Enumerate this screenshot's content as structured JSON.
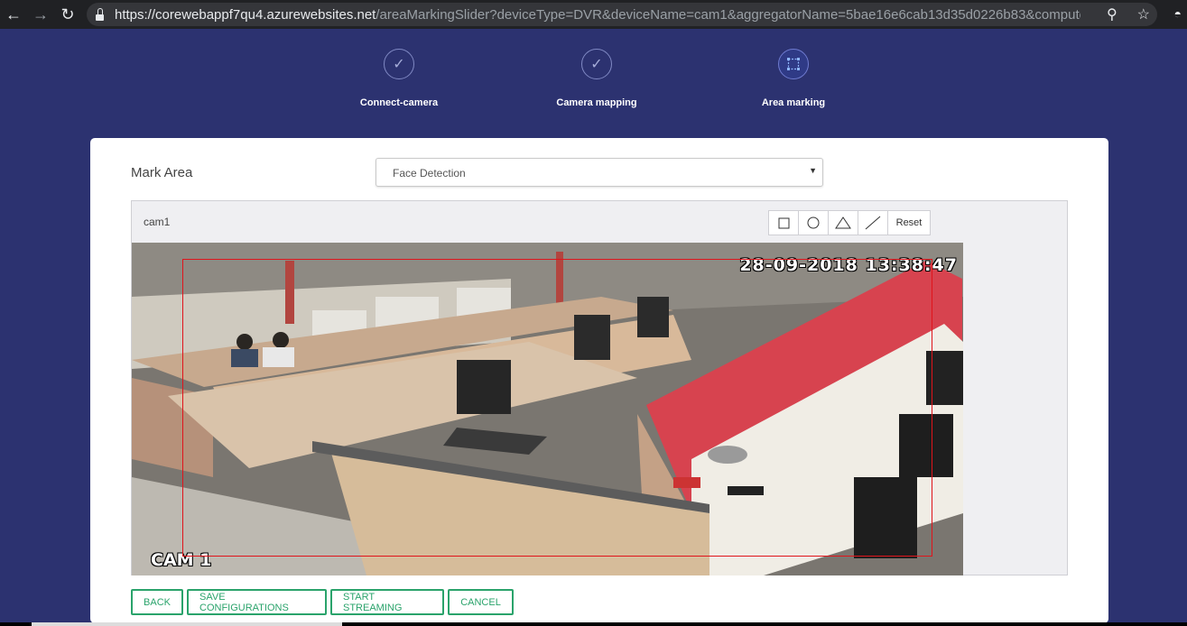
{
  "browser": {
    "url_host": "https://corewebappf7qu4.azurewebsites.net",
    "url_rest": "/areaMarkingSlider?deviceType=DVR&deviceName=cam1&aggregatorName=5bae16e6cab13d35d0226b83&computeEngineNa..."
  },
  "steps": [
    {
      "label": "Connect-camera",
      "icon": "check-icon"
    },
    {
      "label": "Camera mapping",
      "icon": "check-icon"
    },
    {
      "label": "Area marking",
      "icon": "selection-square-icon"
    }
  ],
  "form": {
    "mark_area_label": "Mark Area",
    "selected_option": "Face Detection"
  },
  "camera": {
    "name": "cam1",
    "timestamp": "28-09-2018 13:38:47",
    "overlay_label": "CAM 1"
  },
  "toolbar": {
    "tools": [
      "rectangle-icon",
      "circle-icon",
      "triangle-icon",
      "line-icon"
    ],
    "reset_label": "Reset"
  },
  "actions": {
    "back": "BACK",
    "save": "SAVE CONFIGURATIONS",
    "start": "START STREAMING",
    "cancel": "CANCEL"
  },
  "colors": {
    "background": "#2c3270",
    "accent_green": "#2aa36b",
    "roi_red": "#e0141b"
  }
}
